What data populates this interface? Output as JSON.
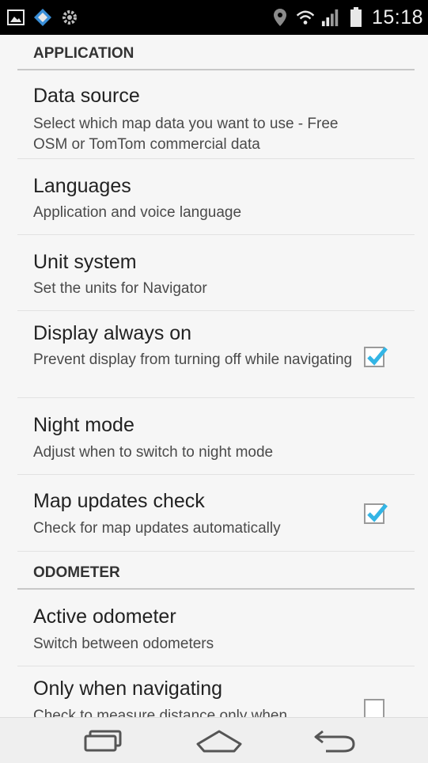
{
  "status_bar": {
    "time": "15:18",
    "left_icons": [
      "image-notification-icon",
      "app-notification-icon",
      "settings-notification-icon"
    ],
    "right_icons": [
      "location-pin-icon",
      "wifi-icon",
      "signal-icon",
      "battery-icon"
    ]
  },
  "sections": [
    {
      "header": "APPLICATION",
      "items": [
        {
          "title": "Data source",
          "summary": "Select which map data you want to use - Free OSM or TomTom commercial data",
          "checkbox": null
        },
        {
          "title": "Languages",
          "summary": "Application and voice language",
          "checkbox": null
        },
        {
          "title": "Unit system",
          "summary": "Set the units for Navigator",
          "checkbox": null
        },
        {
          "title": "Display always on",
          "summary": "Prevent display from turning off while navigating",
          "checkbox": true
        },
        {
          "title": "Night mode",
          "summary": "Adjust when to switch to night mode",
          "checkbox": null
        },
        {
          "title": "Map updates check",
          "summary": "Check for map updates automatically",
          "checkbox": true
        }
      ]
    },
    {
      "header": "ODOMETER",
      "items": [
        {
          "title": "Active odometer",
          "summary": "Switch between odometers",
          "checkbox": null
        },
        {
          "title": "Only when navigating",
          "summary": "Check to measure distance only when",
          "checkbox": false
        }
      ]
    }
  ],
  "nav_bar": {
    "buttons": [
      "recent-apps-icon",
      "home-icon",
      "back-icon"
    ]
  },
  "colors": {
    "accent": "#33b5e5",
    "status_bar": "#000000",
    "background": "#f6f6f6"
  }
}
